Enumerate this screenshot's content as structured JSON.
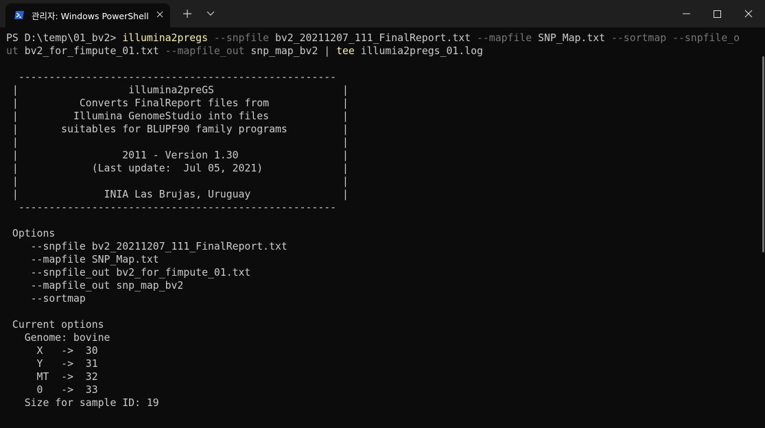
{
  "window": {
    "tab_title": "관리자: Windows PowerShell",
    "icons": {
      "tab": "powershell-icon",
      "close_tab": "close-icon",
      "new_tab": "plus-icon",
      "dropdown": "chevron-down-icon",
      "minimize": "minimize-icon",
      "maximize": "maximize-icon",
      "close_window": "close-icon"
    }
  },
  "colors": {
    "background": "#0c0c0c",
    "titlebar": "#1f1f1f",
    "text": "#cccccc",
    "command": "#f9f1a5",
    "parameter": "#767676",
    "powershell_blue": "#2563c7"
  },
  "terminal": {
    "prompt": "PS D:\\temp\\01_bv2> ",
    "command": {
      "cmd": "illumina2pregs",
      "p1": " --snpfile",
      "v1": " bv2_20211207_111_FinalReport.txt",
      "p2": " --mapfile",
      "v2": " SNP_Map.txt",
      "p3": " --sortmap",
      "p4a": " --snpfile_o",
      "p4b": "ut",
      "v4": " bv2_for_fimpute_01.txt",
      "p5": " --mapfile_out",
      "v5": " snp_map_bv2",
      "pipe": " | ",
      "tee": "tee",
      "v6": " illumia2pregs_01.log"
    },
    "banner": [
      "",
      "  ----------------------------------------------------",
      " |                  illumina2preGS                     |",
      " |          Converts FinalReport files from            |",
      " |         Illumina GenomeStudio into files            |",
      " |       suitables for BLUPF90 family programs         |",
      " |                                                     |",
      " |                 2011 - Version 1.30                 |",
      " |            (Last update:  Jul 05, 2021)             |",
      " |                                                     |",
      " |              INIA Las Brujas, Uruguay               |",
      "  ----------------------------------------------------",
      ""
    ],
    "options": [
      " Options",
      "    --snpfile bv2_20211207_111_FinalReport.txt",
      "    --mapfile SNP_Map.txt",
      "    --snpfile_out bv2_for_fimpute_01.txt",
      "    --mapfile_out snp_map_bv2",
      "    --sortmap",
      ""
    ],
    "current": [
      " Current options",
      "   Genome: bovine",
      "     X   ->  30",
      "     Y   ->  31",
      "     MT  ->  32",
      "     0   ->  33",
      "   Size for sample ID: 19"
    ]
  }
}
